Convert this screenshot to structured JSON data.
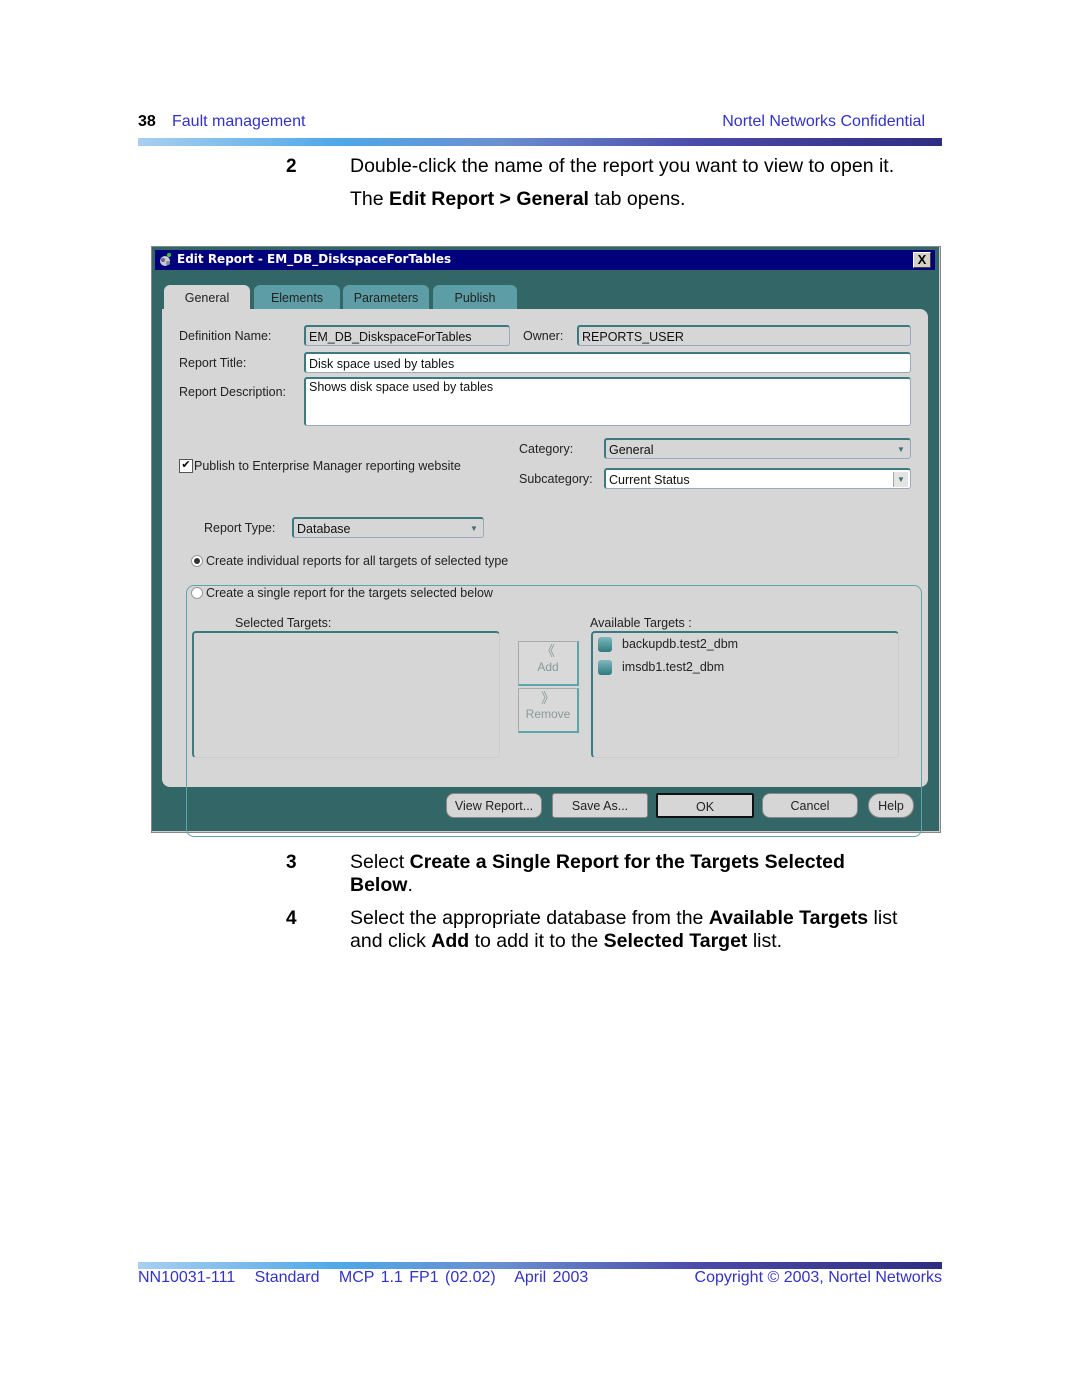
{
  "header": {
    "page_number": "38",
    "section": "Fault management",
    "confidential": "Nortel Networks Confidential"
  },
  "steps": [
    {
      "number": "2",
      "line1": "Double-click the name of the report you want to view to open it.",
      "line2_pre": "The ",
      "line2_bold": "Edit Report > General",
      "line2_post": " tab opens."
    },
    {
      "number": "3",
      "pre": "Select ",
      "bold": "Create a Single Report for the Targets Selected",
      "bold2": "Below",
      "post": "."
    },
    {
      "number": "4",
      "pre": "Select the appropriate database from the ",
      "bold1": "Available Targets",
      "mid1": " list",
      "line2_pre": "and click ",
      "bold2": "Add",
      "mid2": " to add it to the ",
      "bold3": "Selected Target",
      "post": " list."
    }
  ],
  "dialog": {
    "title": "Edit Report - EM_DB_DiskspaceForTables",
    "close_label": "X",
    "tabs": [
      {
        "label": "General",
        "active": true
      },
      {
        "label": "Elements",
        "active": false
      },
      {
        "label": "Parameters",
        "active": false
      },
      {
        "label": "Publish",
        "active": false
      }
    ],
    "form": {
      "definition_name_label": "Definition Name:",
      "definition_name_value": "EM_DB_DiskspaceForTables",
      "owner_label": "Owner:",
      "owner_value": "REPORTS_USER",
      "report_title_label": "Report Title:",
      "report_title_value": "Disk space used by tables",
      "report_description_label": "Report Description:",
      "report_description_value": "Shows disk space used by tables",
      "publish_checkbox_label": "Publish to Enterprise Manager reporting website",
      "publish_checked": true,
      "category_label": "Category:",
      "category_value": "General",
      "subcategory_label": "Subcategory:",
      "subcategory_value": "Current Status"
    },
    "report_type": {
      "label": "Report Type:",
      "value": "Database",
      "option_individual": "Create individual reports for all targets of selected type",
      "option_single": "Create a single report for the targets selected below",
      "selected_option": "individual",
      "selected_targets_label": "Selected Targets:",
      "selected_targets": [],
      "available_targets_label": "Available Targets :",
      "available_targets": [
        "backupdb.test2_dbm",
        "imsdb1.test2_dbm"
      ],
      "add_label": "Add",
      "remove_label": "Remove"
    },
    "buttons": {
      "view_report": "View Report...",
      "save_as": "Save As...",
      "ok": "OK",
      "cancel": "Cancel",
      "help": "Help"
    }
  },
  "footer": {
    "doc_info": "NN10031-111   Standard   MCP 1.1 FP1 (02.02)   April 2003",
    "copyright": "Copyright © 2003, Nortel Networks"
  }
}
